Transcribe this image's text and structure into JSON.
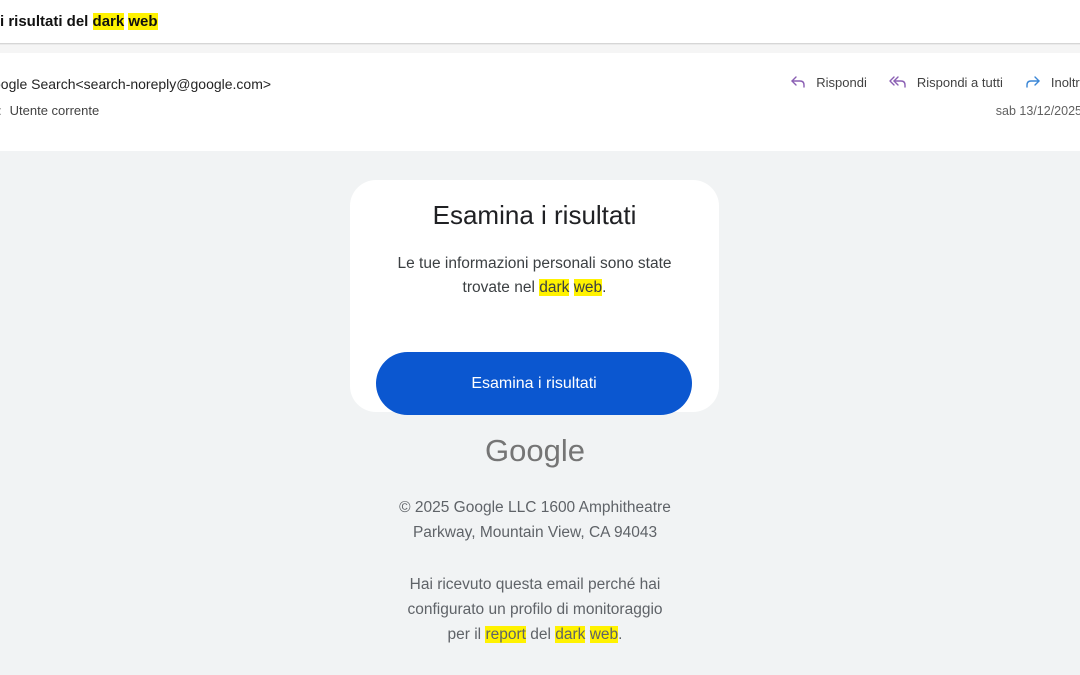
{
  "subject": {
    "prefix": "i risultati del ",
    "highlight1": "dark",
    "highlight2": "web"
  },
  "header": {
    "from": "oogle Search<search-noreply@google.com>",
    "to_label": ":",
    "to_value": "Utente corrente",
    "date": "sab 13/12/2025",
    "actions": {
      "reply": "Rispondi",
      "reply_all": "Rispondi a tutti",
      "forward": "Inoltra"
    },
    "icons": {
      "reply": "reply-icon",
      "reply_all": "reply-all-icon",
      "forward": "forward-icon"
    }
  },
  "card": {
    "title": "Esamina i risultati",
    "line1": "Le tue informazioni personali sono state",
    "line2_prefix": "trovate nel ",
    "line2_hl1": "dark",
    "line2_hl2": "web",
    "line2_suffix": ".",
    "button": "Esamina i risultati"
  },
  "footer": {
    "logo": "Google",
    "copyright_line1": "© 2025 Google LLC 1600 Amphitheatre",
    "copyright_line2": "Parkway, Mountain View, CA 94043",
    "reason_line1": "Hai ricevuto questa email perché hai",
    "reason_line2": "configurato un profilo di monitoraggio",
    "reason_line3_prefix": "per il ",
    "reason_hl_report": "report",
    "reason_mid": " del ",
    "reason_hl_dark": "dark",
    "reason_hl_web": "web",
    "reason_suffix": "."
  },
  "colors": {
    "highlight": "#fff200",
    "button": "#0b57d0",
    "action_icon_purple": "#8a5fb3",
    "action_icon_blue": "#3a86d6",
    "body_bg": "#f1f3f4"
  }
}
